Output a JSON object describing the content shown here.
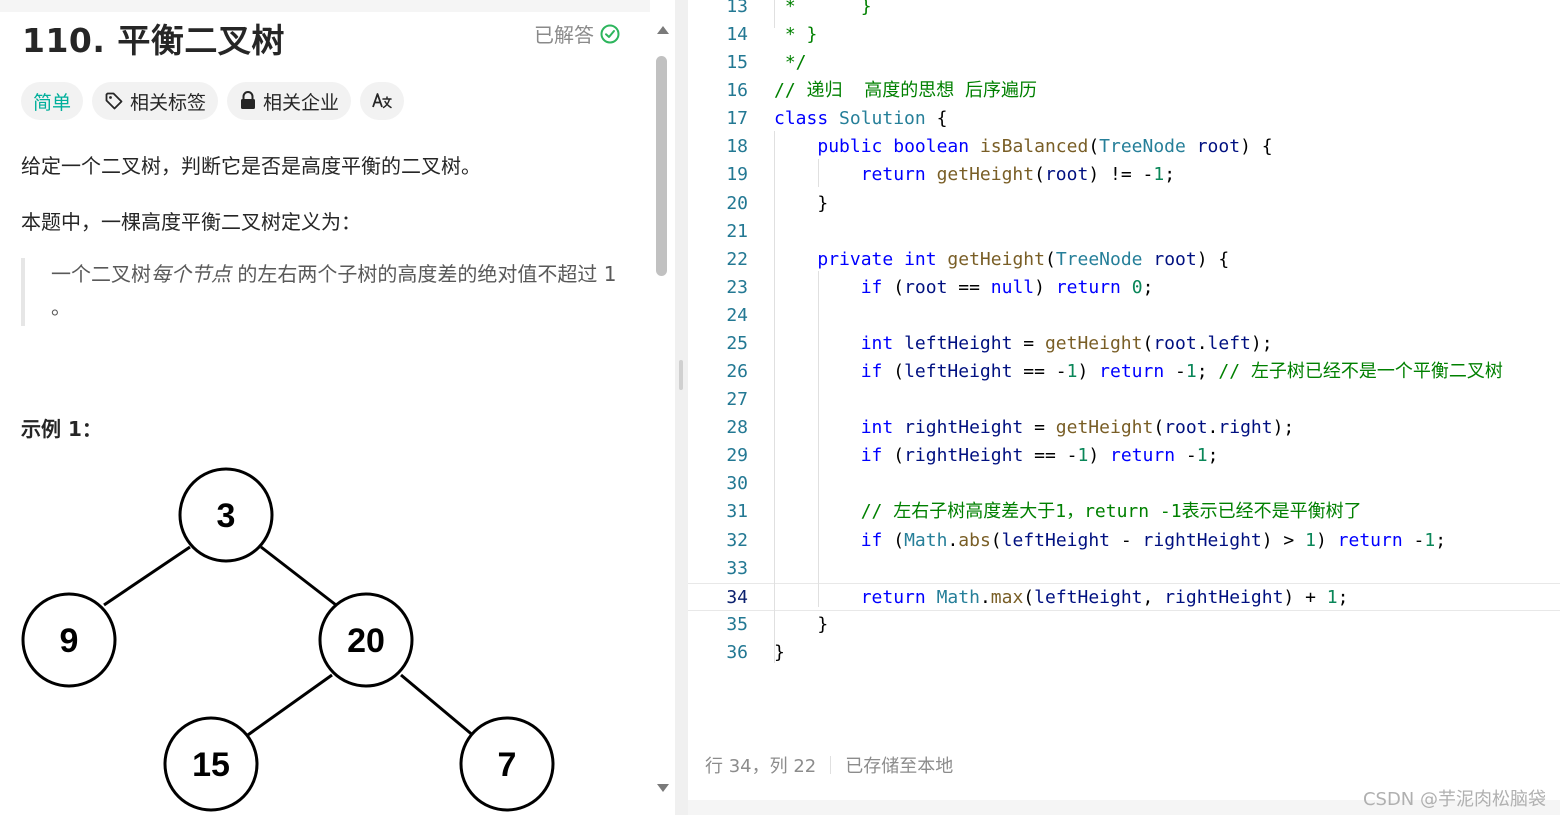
{
  "problem": {
    "title": "110. 平衡二叉树",
    "status_label": "已解答",
    "tags": [
      {
        "label": "简单",
        "icon": ""
      },
      {
        "label": "相关标签",
        "icon": "tag-icon"
      },
      {
        "label": "相关企业",
        "icon": "lock-icon"
      },
      {
        "label": "",
        "icon": "translate-icon"
      }
    ],
    "description1": "给定一个二叉树，判断它是否是高度平衡的二叉树。",
    "description2": "本题中，一棵高度平衡二叉树定义为：",
    "quote_prefix": "一个二叉树",
    "quote_em": "每个节点",
    "quote_suffix": " 的左右两个子树的高度差的绝对值不超过 1 。",
    "example_title": "示例 1：",
    "tree_nodes": [
      "3",
      "9",
      "20",
      "15",
      "7"
    ]
  },
  "editor": {
    "lines": [
      {
        "n": "13",
        "text": " *      }"
      },
      {
        "n": "14",
        "text": " * }"
      },
      {
        "n": "15",
        "text": " */"
      },
      {
        "n": "16",
        "text": "// 递归  高度的思想 后序遍历"
      },
      {
        "n": "17",
        "text": "class Solution {"
      },
      {
        "n": "18",
        "text": "    public boolean isBalanced(TreeNode root) {"
      },
      {
        "n": "19",
        "text": "        return getHeight(root) != -1;"
      },
      {
        "n": "20",
        "text": "    }"
      },
      {
        "n": "21",
        "text": ""
      },
      {
        "n": "22",
        "text": "    private int getHeight(TreeNode root) {"
      },
      {
        "n": "23",
        "text": "        if (root == null) return 0;"
      },
      {
        "n": "24",
        "text": ""
      },
      {
        "n": "25",
        "text": "        int leftHeight = getHeight(root.left);"
      },
      {
        "n": "26",
        "text": "        if (leftHeight == -1) return -1; // 左子树已经不是一个平衡二叉树"
      },
      {
        "n": "27",
        "text": ""
      },
      {
        "n": "28",
        "text": "        int rightHeight = getHeight(root.right);"
      },
      {
        "n": "29",
        "text": "        if (rightHeight == -1) return -1;"
      },
      {
        "n": "30",
        "text": ""
      },
      {
        "n": "31",
        "text": "        // 左右子树高度差大于1，return -1表示已经不是平衡树了"
      },
      {
        "n": "32",
        "text": "        if (Math.abs(leftHeight - rightHeight) > 1) return -1;"
      },
      {
        "n": "33",
        "text": ""
      },
      {
        "n": "34",
        "text": "        return Math.max(leftHeight, rightHeight) + 1;"
      },
      {
        "n": "35",
        "text": "    }"
      },
      {
        "n": "36",
        "text": "}"
      }
    ],
    "cursor_line": "34",
    "status_position": "行 34，列 22",
    "status_saved": "已存储至本地",
    "watermark": "CSDN @芋泥肉松脑袋"
  },
  "colors": {
    "easy": "#00af9b",
    "keyword": "#0000ff",
    "type": "#267f99",
    "function": "#795e26",
    "variable": "#001080",
    "number": "#098658",
    "comment": "#008000",
    "line_number": "#237893",
    "solved_check": "#2db55d"
  }
}
